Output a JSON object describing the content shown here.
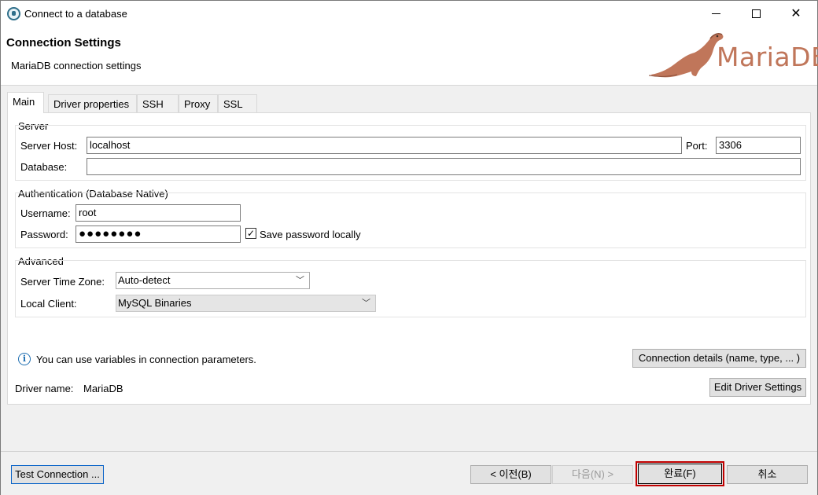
{
  "window": {
    "title": "Connect to a database",
    "minimize_icon": "minimize-icon",
    "maximize_icon": "maximize-icon",
    "close_icon": "close-icon"
  },
  "header": {
    "title": "Connection Settings",
    "subtitle": "MariaDB connection settings",
    "logo_text": "MariaDB",
    "logo_color": "#c0765a"
  },
  "tabs": [
    {
      "label": "Main",
      "active": true
    },
    {
      "label": "Driver properties",
      "active": false
    },
    {
      "label": "SSH",
      "active": false
    },
    {
      "label": "Proxy",
      "active": false
    },
    {
      "label": "SSL",
      "active": false
    }
  ],
  "server": {
    "section_title": "Server",
    "host_label": "Server Host:",
    "host_value": "localhost",
    "port_label": "Port:",
    "port_value": "3306",
    "database_label": "Database:",
    "database_value": ""
  },
  "auth": {
    "section_title": "Authentication (Database Native)",
    "username_label": "Username:",
    "username_value": "root",
    "password_label": "Password:",
    "password_masked": "●●●●●●●●",
    "save_password_label": "Save password locally",
    "save_password_checked": true,
    "check_glyph": "✓"
  },
  "advanced": {
    "section_title": "Advanced",
    "timezone_label": "Server Time Zone:",
    "timezone_value": "Auto-detect",
    "local_client_label": "Local Client:",
    "local_client_value": "MySQL Binaries"
  },
  "info": {
    "icon": "info-icon",
    "text": "You can use variables in connection parameters.",
    "connection_details_button": "Connection details (name, type, ... )",
    "driver_name_label": "Driver name:",
    "driver_name_value": "MariaDB",
    "edit_driver_button": "Edit Driver Settings"
  },
  "footer": {
    "test_connection": "Test Connection ...",
    "back": "< 이전(B)",
    "next": "다음(N) >",
    "finish": "완료(F)",
    "cancel": "취소"
  }
}
